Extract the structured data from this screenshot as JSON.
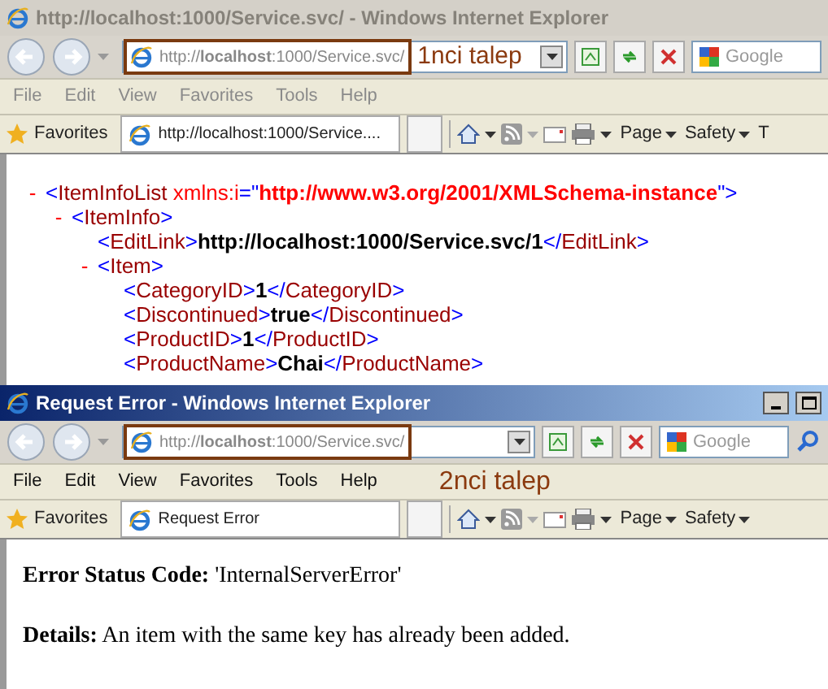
{
  "windows": [
    {
      "title": "http://localhost:1000/Service.svc/ - Windows Internet Explorer",
      "active": false,
      "show_controls": false,
      "address": "http://**localhost**:1000/Service.svc/",
      "search_placeholder": "Google",
      "address_annotation": "1nci talep",
      "menu": [
        "File",
        "Edit",
        "View",
        "Favorites",
        "Tools",
        "Help"
      ],
      "favorites": "Favorites",
      "tab": "http://localhost:1000/Service....",
      "commands": [
        "Page",
        "Safety",
        "T"
      ],
      "content": {
        "kind": "xml",
        "nodes": [
          {
            "toggle": "-",
            "parts": [
              {
                "kind": "punct",
                "text": "<"
              },
              {
                "kind": "name",
                "text": "ItemInfoList"
              },
              {
                "kind": "attr",
                "text": " xmlns:i"
              },
              {
                "kind": "punct",
                "text": "=\""
              },
              {
                "kind": "value",
                "text": "http://www.w3.org/2001/XMLSchema-instance"
              },
              {
                "kind": "punct",
                "text": "\">"
              }
            ],
            "children": [
              {
                "toggle": "-",
                "parts": [
                  {
                    "kind": "punct",
                    "text": "<"
                  },
                  {
                    "kind": "name",
                    "text": "ItemInfo"
                  },
                  {
                    "kind": "punct",
                    "text": ">"
                  }
                ],
                "children": [
                  {
                    "parts": [
                      {
                        "kind": "punct",
                        "text": "<"
                      },
                      {
                        "kind": "name",
                        "text": "EditLink"
                      },
                      {
                        "kind": "punct",
                        "text": ">"
                      },
                      {
                        "kind": "text",
                        "text": "http://localhost:1000/Service.svc/1"
                      },
                      {
                        "kind": "punct",
                        "text": "</"
                      },
                      {
                        "kind": "name",
                        "text": "EditLink"
                      },
                      {
                        "kind": "punct",
                        "text": ">"
                      }
                    ]
                  },
                  {
                    "toggle": "-",
                    "parts": [
                      {
                        "kind": "punct",
                        "text": "<"
                      },
                      {
                        "kind": "name",
                        "text": "Item"
                      },
                      {
                        "kind": "punct",
                        "text": ">"
                      }
                    ],
                    "children": [
                      {
                        "parts": [
                          {
                            "kind": "punct",
                            "text": "<"
                          },
                          {
                            "kind": "name",
                            "text": "CategoryID"
                          },
                          {
                            "kind": "punct",
                            "text": ">"
                          },
                          {
                            "kind": "text",
                            "text": "1"
                          },
                          {
                            "kind": "punct",
                            "text": "</"
                          },
                          {
                            "kind": "name",
                            "text": "CategoryID"
                          },
                          {
                            "kind": "punct",
                            "text": ">"
                          }
                        ]
                      },
                      {
                        "parts": [
                          {
                            "kind": "punct",
                            "text": "<"
                          },
                          {
                            "kind": "name",
                            "text": "Discontinued"
                          },
                          {
                            "kind": "punct",
                            "text": ">"
                          },
                          {
                            "kind": "text",
                            "text": "true"
                          },
                          {
                            "kind": "punct",
                            "text": "</"
                          },
                          {
                            "kind": "name",
                            "text": "Discontinued"
                          },
                          {
                            "kind": "punct",
                            "text": ">"
                          }
                        ]
                      },
                      {
                        "parts": [
                          {
                            "kind": "punct",
                            "text": "<"
                          },
                          {
                            "kind": "name",
                            "text": "ProductID"
                          },
                          {
                            "kind": "punct",
                            "text": ">"
                          },
                          {
                            "kind": "text",
                            "text": "1"
                          },
                          {
                            "kind": "punct",
                            "text": "</"
                          },
                          {
                            "kind": "name",
                            "text": "ProductID"
                          },
                          {
                            "kind": "punct",
                            "text": ">"
                          }
                        ]
                      },
                      {
                        "parts": [
                          {
                            "kind": "punct",
                            "text": "<"
                          },
                          {
                            "kind": "name",
                            "text": "ProductName"
                          },
                          {
                            "kind": "punct",
                            "text": ">"
                          },
                          {
                            "kind": "text",
                            "text": "Chai"
                          },
                          {
                            "kind": "punct",
                            "text": "</"
                          },
                          {
                            "kind": "name",
                            "text": "ProductName"
                          },
                          {
                            "kind": "punct",
                            "text": ">"
                          }
                        ]
                      }
                    ]
                  }
                ]
              }
            ]
          }
        ]
      }
    },
    {
      "title": "Request Error - Windows Internet Explorer",
      "active": true,
      "show_controls": true,
      "address": "http://**localhost**:1000/Service.svc/",
      "search_placeholder": "Google",
      "menu_annotation": "2nci talep",
      "menu": [
        "File",
        "Edit",
        "View",
        "Favorites",
        "Tools",
        "Help"
      ],
      "favorites": "Favorites",
      "tab": "Request Error",
      "commands": [
        "Page",
        "Safety"
      ],
      "content": {
        "kind": "error",
        "paragraphs": [
          "**Error Status Code:** 'InternalServerError'",
          "**Details:** An item with the same key has already been added."
        ]
      }
    }
  ]
}
